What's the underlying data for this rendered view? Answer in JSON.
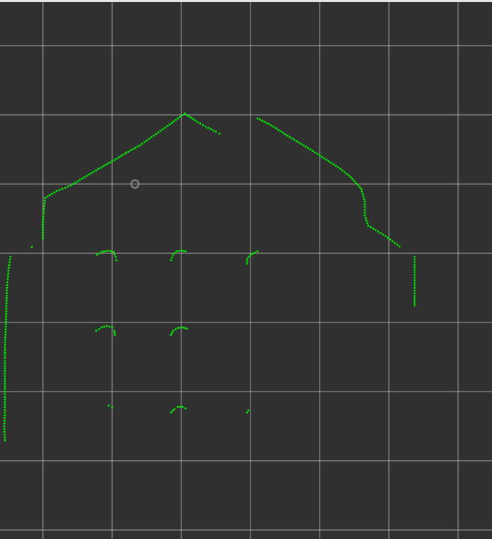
{
  "view": {
    "background_color": "#303030",
    "grid_color": "#a0a0a0",
    "point_color": "#00ee00",
    "sensor_color": "#808080",
    "border_color": "#e6e6e6",
    "sensor_icon": "sensor-origin-icon"
  },
  "grid": {
    "cell_size_m": 1
  },
  "sensor": {
    "x": 1.33,
    "y": 3.0
  },
  "scan_segments": [
    {
      "name": "roof-left",
      "points": [
        [
          0.0,
          2.22
        ],
        [
          0.0,
          2.45
        ],
        [
          0.01,
          2.6
        ],
        [
          0.03,
          2.8
        ],
        [
          0.2,
          2.9
        ],
        [
          0.4,
          2.98
        ],
        [
          0.6,
          3.1
        ],
        [
          0.8,
          3.22
        ],
        [
          1.0,
          3.33
        ],
        [
          1.2,
          3.45
        ],
        [
          1.4,
          3.56
        ],
        [
          1.6,
          3.7
        ],
        [
          1.8,
          3.84
        ],
        [
          1.95,
          3.95
        ],
        [
          2.05,
          4.02
        ]
      ]
    },
    {
      "name": "roof-center-right",
      "points": [
        [
          2.05,
          4.02
        ],
        [
          2.2,
          3.92
        ],
        [
          2.35,
          3.83
        ],
        [
          2.5,
          3.76
        ],
        [
          2.55,
          3.73
        ]
      ]
    },
    {
      "name": "roof-right",
      "points": [
        [
          3.1,
          3.95
        ],
        [
          3.3,
          3.85
        ],
        [
          3.5,
          3.72
        ],
        [
          3.7,
          3.6
        ],
        [
          3.9,
          3.48
        ],
        [
          4.1,
          3.35
        ],
        [
          4.3,
          3.22
        ],
        [
          4.45,
          3.1
        ],
        [
          4.6,
          2.93
        ],
        [
          4.65,
          2.75
        ],
        [
          4.65,
          2.55
        ],
        [
          4.7,
          2.4
        ],
        [
          4.95,
          2.25
        ],
        [
          5.15,
          2.1
        ]
      ]
    },
    {
      "name": "right-wall",
      "points": [
        [
          5.37,
          1.95
        ],
        [
          5.37,
          1.8
        ],
        [
          5.37,
          1.65
        ],
        [
          5.37,
          1.5
        ],
        [
          5.37,
          1.35
        ],
        [
          5.37,
          1.25
        ]
      ]
    },
    {
      "name": "left-wall",
      "points": [
        [
          -0.47,
          1.95
        ],
        [
          -0.5,
          1.75
        ],
        [
          -0.52,
          1.5
        ],
        [
          -0.53,
          1.2
        ],
        [
          -0.54,
          0.9
        ],
        [
          -0.55,
          0.6
        ],
        [
          -0.55,
          0.3
        ],
        [
          -0.55,
          0.0
        ],
        [
          -0.55,
          -0.3
        ],
        [
          -0.56,
          -0.5
        ],
        [
          -0.55,
          -0.7
        ]
      ]
    },
    {
      "name": "stray-left",
      "points": [
        [
          -0.16,
          2.09
        ]
      ]
    },
    {
      "name": "post-1-1",
      "points": [
        [
          0.78,
          1.98
        ],
        [
          0.85,
          2.02
        ],
        [
          0.95,
          2.04
        ],
        [
          1.02,
          2.02
        ],
        [
          1.05,
          1.95
        ],
        [
          1.06,
          1.9
        ]
      ]
    },
    {
      "name": "post-1-2",
      "points": [
        [
          1.85,
          1.9
        ],
        [
          1.88,
          1.98
        ],
        [
          1.93,
          2.03
        ],
        [
          2.0,
          2.04
        ],
        [
          2.06,
          2.03
        ]
      ]
    },
    {
      "name": "post-1-3",
      "points": [
        [
          2.95,
          1.85
        ],
        [
          2.95,
          1.92
        ],
        [
          3.0,
          1.98
        ],
        [
          3.06,
          2.01
        ],
        [
          3.1,
          2.03
        ]
      ]
    },
    {
      "name": "post-2-1",
      "points": [
        [
          0.77,
          0.88
        ],
        [
          0.85,
          0.93
        ],
        [
          0.92,
          0.95
        ],
        [
          1.0,
          0.93
        ],
        [
          1.03,
          0.88
        ],
        [
          1.04,
          0.82
        ]
      ]
    },
    {
      "name": "post-2-2",
      "points": [
        [
          1.85,
          0.82
        ],
        [
          1.88,
          0.88
        ],
        [
          1.95,
          0.92
        ],
        [
          2.02,
          0.93
        ],
        [
          2.08,
          0.91
        ]
      ]
    },
    {
      "name": "post-3-1",
      "points": [
        [
          0.95,
          -0.2
        ],
        [
          1.0,
          -0.23
        ]
      ]
    },
    {
      "name": "post-3-2",
      "points": [
        [
          1.85,
          -0.3
        ],
        [
          1.9,
          -0.25
        ],
        [
          1.95,
          -0.22
        ],
        [
          2.02,
          -0.22
        ],
        [
          2.06,
          -0.24
        ]
      ]
    },
    {
      "name": "post-3-3",
      "points": [
        [
          2.95,
          -0.3
        ],
        [
          2.97,
          -0.27
        ]
      ]
    }
  ]
}
